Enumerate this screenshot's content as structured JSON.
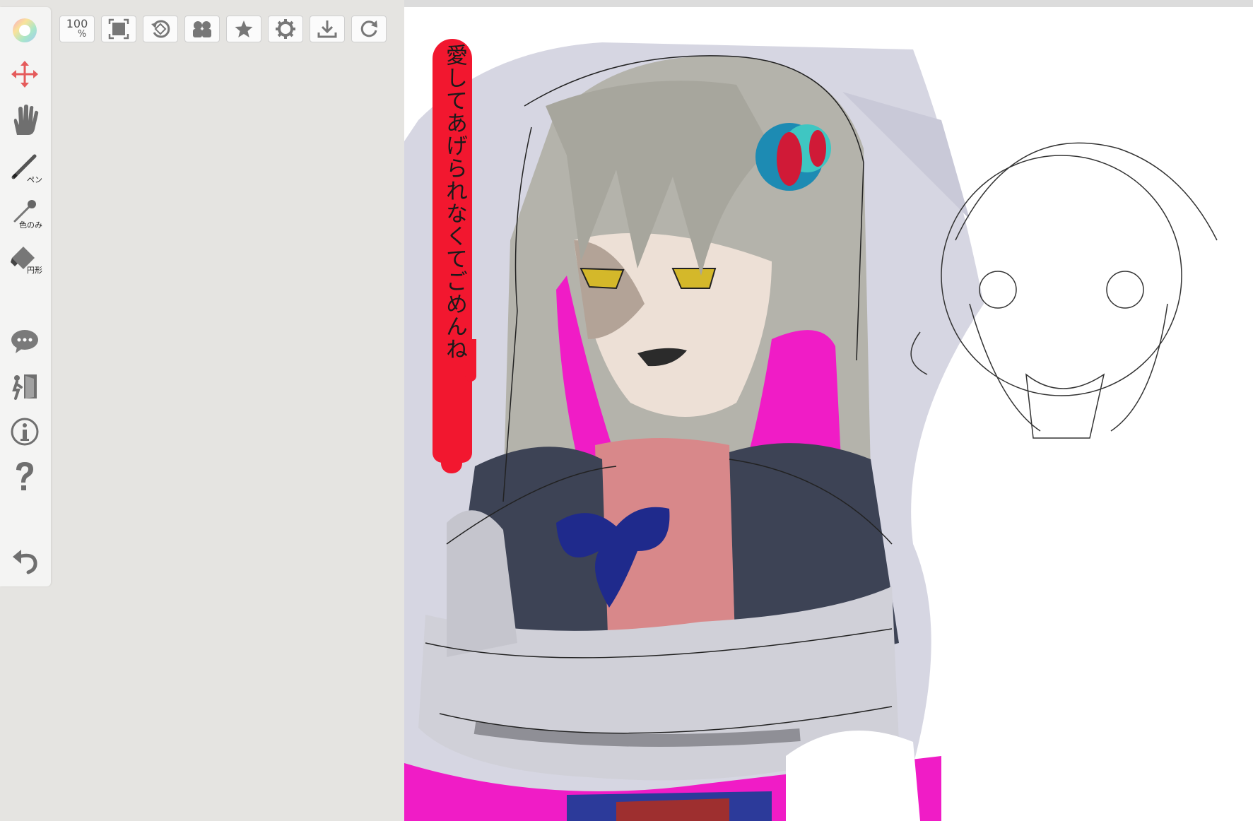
{
  "toolbar": {
    "tools": [
      {
        "name": "color-wheel-icon"
      },
      {
        "name": "move-icon"
      },
      {
        "name": "hand-icon"
      },
      {
        "name": "pen-icon",
        "sublabel": "ペン"
      },
      {
        "name": "eyedropper-icon",
        "sublabel": "色のみ"
      },
      {
        "name": "eraser-icon",
        "sublabel": "円形"
      },
      {
        "name": "chat-icon"
      },
      {
        "name": "exit-icon"
      },
      {
        "name": "info-icon"
      },
      {
        "name": "help-icon"
      },
      {
        "name": "undo-icon"
      }
    ]
  },
  "topbar": {
    "zoom_value": "100",
    "zoom_unit": "%",
    "buttons": [
      "zoom-100-button",
      "fit-screen-button",
      "rotate-reset-button",
      "users-button",
      "favorite-button",
      "settings-button",
      "download-button",
      "reload-button"
    ]
  },
  "canvas": {
    "caption": "愛してあげられなくてごめんね"
  },
  "colors": {
    "background": "#e5e4e1",
    "toolbar": "#f4f4f3",
    "accent_move": "#e55b5b",
    "icon_gray": "#6f6f6f",
    "magenta": "#f01cc6",
    "red_banner": "#f2172f",
    "hair": "#b4b3ab",
    "bow": "#1f2a8c"
  }
}
